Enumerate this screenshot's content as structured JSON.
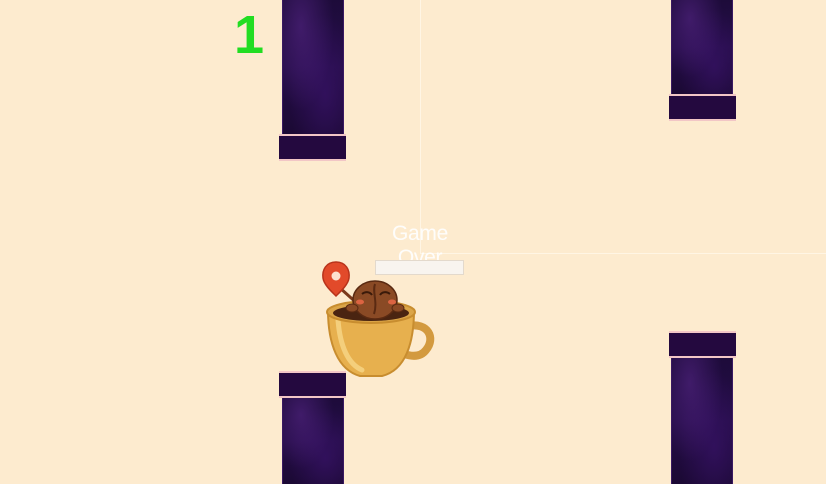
{
  "game": {
    "score": "1",
    "status_text": "Game Over",
    "background_color": "#fdebcf",
    "score_color": "#22dd22",
    "pipe_color": "#24093f",
    "pipe_cap_border_color": "#f2c6c6"
  },
  "player": {
    "sprite": "coffee-cup-with-bean-character",
    "pin_icon": "map-pin-icon"
  }
}
